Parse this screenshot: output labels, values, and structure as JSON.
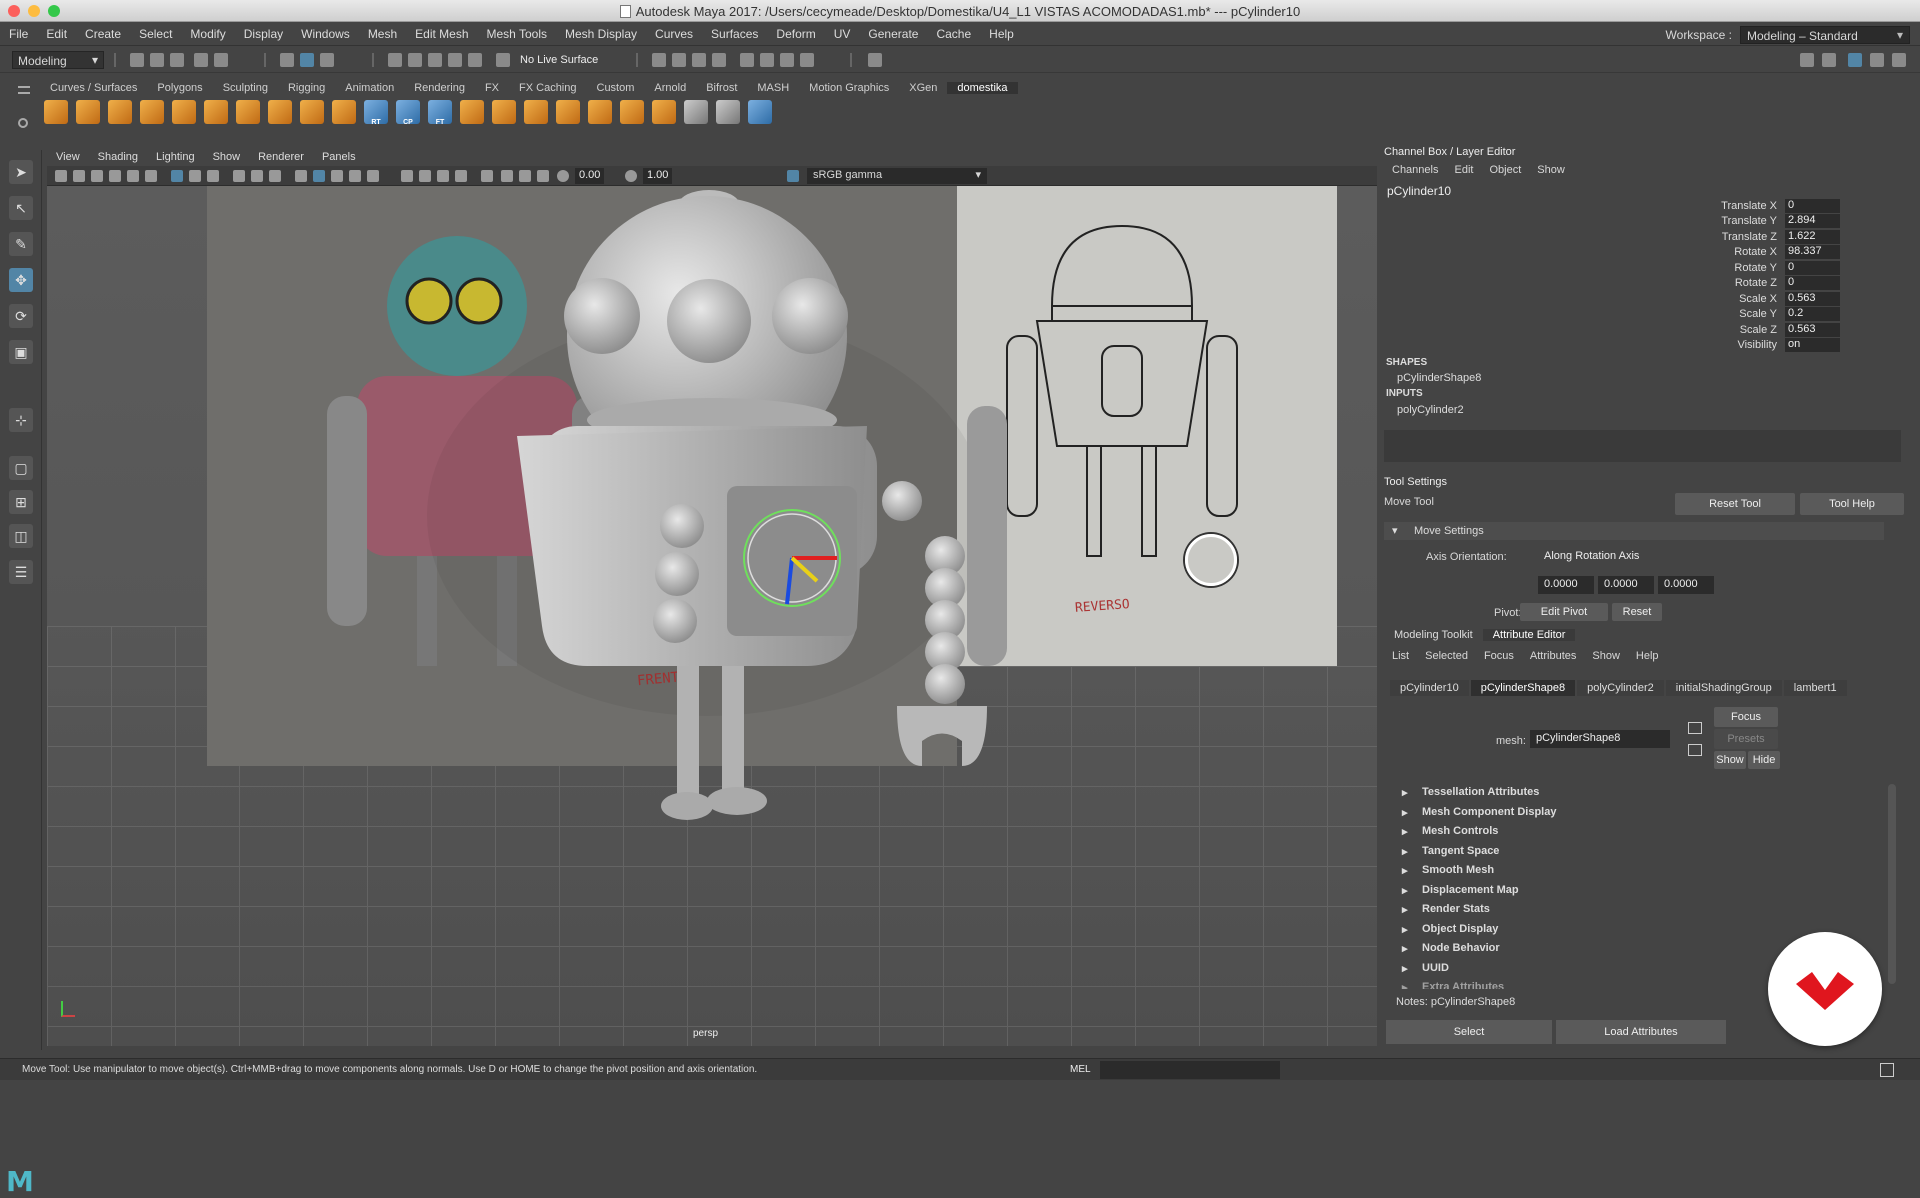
{
  "window": {
    "title": "Autodesk Maya 2017: /Users/cecymeade/Desktop/Domestika/U4_L1 VISTAS ACOMODADAS1.mb* --- pCylinder10",
    "traffic_colors": [
      "#fc605c",
      "#fdbc40",
      "#34c84a"
    ]
  },
  "menus": [
    "File",
    "Edit",
    "Create",
    "Select",
    "Modify",
    "Display",
    "Windows",
    "Mesh",
    "Edit Mesh",
    "Mesh Tools",
    "Mesh Display",
    "Curves",
    "Surfaces",
    "Deform",
    "UV",
    "Generate",
    "Cache",
    "Help"
  ],
  "workspace": {
    "label": "Workspace :",
    "value": "Modeling – Standard"
  },
  "status_line": {
    "mode": "Modeling",
    "live_surface": "No Live Surface"
  },
  "shelf_tabs": [
    "Curves / Surfaces",
    "Polygons",
    "Sculpting",
    "Rigging",
    "Animation",
    "Rendering",
    "FX",
    "FX Caching",
    "Custom",
    "Arnold",
    "Bifrost",
    "MASH",
    "Motion Graphics",
    "XGen",
    "domestika"
  ],
  "shelf_active": "domestika",
  "shelf_icon_labels": {
    "rt": "RT",
    "cp": "CP",
    "ft": "FT"
  },
  "viewport": {
    "menu": [
      "View",
      "Shading",
      "Lighting",
      "Show",
      "Renderer",
      "Panels"
    ],
    "exposure": "0.00",
    "gamma_value": "1.00",
    "color_space": "sRGB gamma",
    "camera": "persp",
    "ref_left_text": "FRENTE",
    "ref_right_text": "REVERSO"
  },
  "channel_box": {
    "header": "Channel Box / Layer Editor",
    "menu": [
      "Channels",
      "Edit",
      "Object",
      "Show"
    ],
    "object": "pCylinder10",
    "channels": [
      {
        "label": "Translate X",
        "value": "0"
      },
      {
        "label": "Translate Y",
        "value": "2.894"
      },
      {
        "label": "Translate Z",
        "value": "1.622"
      },
      {
        "label": "Rotate X",
        "value": "98.337"
      },
      {
        "label": "Rotate Y",
        "value": "0"
      },
      {
        "label": "Rotate Z",
        "value": "0"
      },
      {
        "label": "Scale X",
        "value": "0.563"
      },
      {
        "label": "Scale Y",
        "value": "0.2"
      },
      {
        "label": "Scale Z",
        "value": "0.563"
      },
      {
        "label": "Visibility",
        "value": "on"
      }
    ],
    "shapes_label": "SHAPES",
    "shape": "pCylinderShape8",
    "inputs_label": "INPUTS",
    "input": "polyCylinder2"
  },
  "tool_settings": {
    "header": "Tool Settings",
    "tool": "Move Tool",
    "reset": "Reset Tool",
    "help": "Tool Help",
    "section": "Move Settings",
    "axis_label": "Axis Orientation:",
    "axis_value": "Along Rotation Axis",
    "xyz": [
      "0.0000",
      "0.0000",
      "0.0000"
    ],
    "pivot_label": "Pivot:",
    "edit_pivot": "Edit Pivot",
    "pivot_reset": "Reset"
  },
  "attribute_editor": {
    "tabs": [
      "Modeling Toolkit",
      "Attribute Editor"
    ],
    "menu": [
      "List",
      "Selected",
      "Focus",
      "Attributes",
      "Show",
      "Help"
    ],
    "node_tabs": [
      "pCylinder10",
      "pCylinderShape8",
      "polyCylinder2",
      "initialShadingGroup",
      "lambert1"
    ],
    "mesh_label": "mesh:",
    "mesh_value": "pCylinderShape8",
    "focus": "Focus",
    "presets": "Presets",
    "show": "Show",
    "hide": "Hide",
    "sections": [
      "Tessellation Attributes",
      "Mesh Component Display",
      "Mesh Controls",
      "Tangent Space",
      "Smooth Mesh",
      "Displacement Map",
      "Render Stats",
      "Object Display",
      "Node Behavior",
      "UUID",
      "Extra Attributes"
    ],
    "notes": "Notes:  pCylinderShape8",
    "select": "Select",
    "load": "Load Attributes"
  },
  "help_line": {
    "text": "Move Tool: Use manipulator to move object(s). Ctrl+MMB+drag to move components along normals. Use D or HOME to change the pivot position and axis orientation.",
    "mel": "MEL"
  },
  "colors": {
    "accent": "#5285a6",
    "logo_red": "#e0161e",
    "maya_teal": "#4fb8c8"
  }
}
